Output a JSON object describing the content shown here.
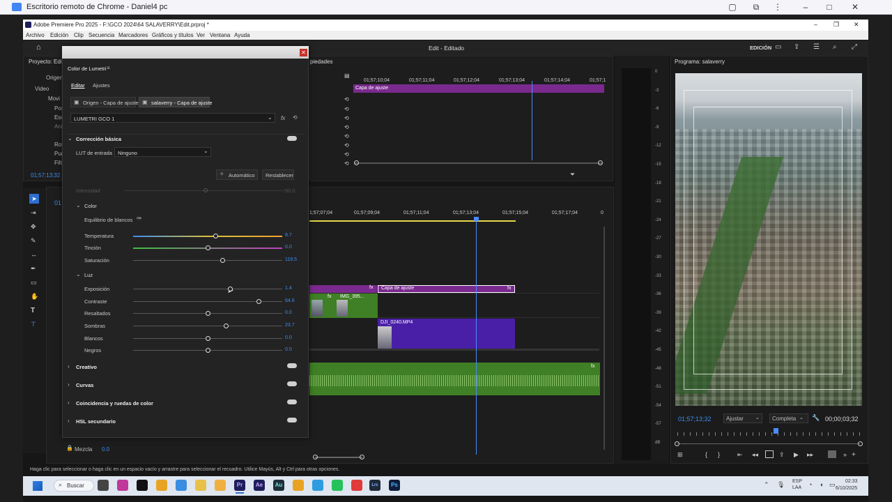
{
  "remote_desktop": {
    "title": "Escritorio remoto de Chrome - Daniel4 pc"
  },
  "premiere": {
    "window_title": "Adobe Premiere Pro 2025 - F:\\GCO 2024\\64 SALAVERRY\\Edit.prproj *",
    "menu": [
      "Archivo",
      "Edición",
      "Clip",
      "Secuencia",
      "Marcadores",
      "Gráficos y títulos",
      "Ver",
      "Ventana",
      "Ayuda"
    ],
    "workspace_title": "Edit - Editado",
    "edicion_label": "EDICIÓN",
    "project_panel": "Proyecto: Edit",
    "project_tab_origen": "Origen",
    "project_video": "Video",
    "project_items": [
      "Movi",
      "Pos",
      "Esc",
      "Ani",
      "Rot",
      "Pun",
      "Filt"
    ],
    "project_timecode": "01;57;13;32",
    "properties_tab": "piedades",
    "upper_timeline_ticks": [
      "01;57;10;04",
      "01;57;11;04",
      "01;57;12;04",
      "01;57;13;04",
      "01;57;14;04",
      "01;57;1"
    ],
    "upper_clip": "Capa de ajuste",
    "timeline_ticks": [
      "1;57;07;04",
      "01;57;09;04",
      "01;57;11;04",
      "01;57;13;04",
      "01;57;15;04",
      "01;57;17;04",
      "0"
    ],
    "timeline_partial_timecode": "01",
    "clips": {
      "adjust_left_fx": "fx",
      "adjust_right": "Capa de ajuste",
      "adjust_right_fx": "fx",
      "img_clip": "IMG_395...",
      "img_clip_fx": "fx",
      "dji_clip": "DJI_0240.MP4",
      "audio_fx": "fx"
    },
    "mix_label": "Mezcla",
    "mix_value": "0.0",
    "meter_scale": [
      "0",
      "-3",
      "-6",
      "-9",
      "-12",
      "-15",
      "-18",
      "-21",
      "-24",
      "-27",
      "-30",
      "-33",
      "-36",
      "-39",
      "-42",
      "-45",
      "-48",
      "-51",
      "-54",
      "-57",
      "dB"
    ],
    "program": {
      "title": "Programa: salaverry",
      "timecode": "01;57;13;32",
      "fit": "Ajustar",
      "quality": "Completa",
      "duration": "00;00;03;32"
    },
    "status_text": "Haga clic para seleccionar o haga clic en un espacio vacío y arrastre para seleccionar el recuadro. Utilice Mayús, Alt y Ctrl para otras opciones.",
    "lumetri": {
      "panel_title": "Color de Lumetri",
      "tabs": [
        "Editar",
        "Ajustes"
      ],
      "source_tabs": [
        "Origen - Capa de ajuste",
        "salaverry - Capa de ajuste"
      ],
      "preset": "LUMETRI GCO 1",
      "fx_label": "fx",
      "section_basic": "Corrección básica",
      "lut_label": "LUT de entrada",
      "lut_value": "Ninguno",
      "auto_label": "Automático",
      "reset_label": "Restablecer",
      "intensity_label": "Intensidad",
      "intensity_value": "50.0",
      "color_label": "Color",
      "white_balance": "Equilibrio de blancos",
      "light_label": "Luz",
      "sliders": [
        {
          "label": "Temperatura",
          "value": "8.7",
          "level": 0.55
        },
        {
          "label": "Tinción",
          "value": "0.0",
          "level": 0.5
        },
        {
          "label": "Saturación",
          "value": "119.5",
          "level": 0.6
        },
        {
          "label": "Exposición",
          "value": "1.4",
          "level": 0.65
        },
        {
          "label": "Contraste",
          "value": "64.6",
          "level": 0.84
        },
        {
          "label": "Resaltados",
          "value": "0.0",
          "level": 0.5
        },
        {
          "label": "Sombras",
          "value": "23.7",
          "level": 0.62
        },
        {
          "label": "Blancos",
          "value": "0.0",
          "level": 0.5
        },
        {
          "label": "Negros",
          "value": "0.0",
          "level": 0.5
        }
      ],
      "collapsed_sections": [
        "Creativo",
        "Curvas",
        "Coincidencia y ruedas de color",
        "HSL secundario"
      ]
    }
  },
  "taskbar": {
    "search": "Buscar",
    "lang": "ESP",
    "lang2": "LAA",
    "time": "02:33",
    "date": "6/10/2025",
    "apps": [
      "Pr",
      "Ae",
      "Au",
      "Lrc",
      "Ps"
    ]
  }
}
